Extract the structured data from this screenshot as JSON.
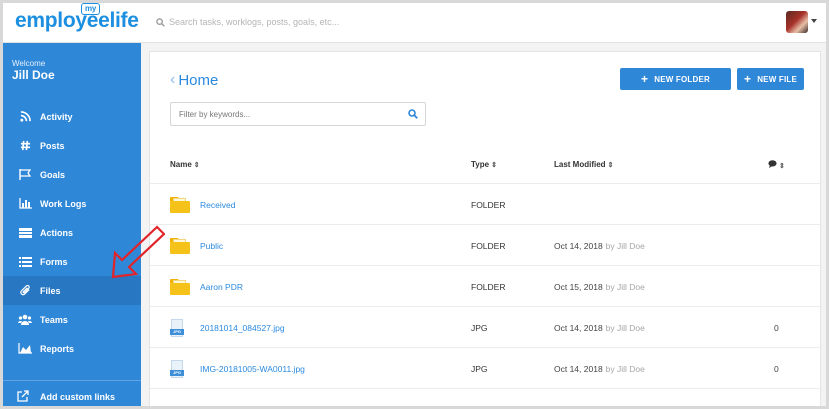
{
  "app": {
    "logo_my": "my",
    "logo_text": "employeelife",
    "search_placeholder": "Search tasks, worklogs, posts, goals, etc..."
  },
  "sidebar": {
    "welcome": "Welcome",
    "user_name": "Jill Doe",
    "items": [
      {
        "label": "Activity",
        "icon": "rss-icon"
      },
      {
        "label": "Posts",
        "icon": "hashtag-icon"
      },
      {
        "label": "Goals",
        "icon": "flag-icon"
      },
      {
        "label": "Work Logs",
        "icon": "bar-chart-icon"
      },
      {
        "label": "Actions",
        "icon": "list-box-icon"
      },
      {
        "label": "Forms",
        "icon": "list-icon"
      },
      {
        "label": "Files",
        "icon": "paperclip-icon",
        "active": true
      },
      {
        "label": "Teams",
        "icon": "users-icon"
      },
      {
        "label": "Reports",
        "icon": "area-chart-icon"
      }
    ],
    "custom_links_label": "Add custom links"
  },
  "main": {
    "title": "Home",
    "new_folder_label": "NEW FOLDER",
    "new_file_label": "NEW FILE",
    "filter_placeholder": "Filter by keywords...",
    "columns": {
      "name": "Name",
      "type": "Type",
      "modified": "Last Modified",
      "comments_icon": "comment-icon"
    },
    "rows": [
      {
        "kind": "folder",
        "name": "Received",
        "type": "FOLDER",
        "modified": "",
        "by": "",
        "comments": ""
      },
      {
        "kind": "folder",
        "name": "Public",
        "type": "FOLDER",
        "modified": "Oct 14, 2018",
        "by": "by Jill Doe",
        "comments": ""
      },
      {
        "kind": "folder",
        "name": "Aaron PDR",
        "type": "FOLDER",
        "modified": "Oct 15, 2018",
        "by": "by Jill Doe",
        "comments": ""
      },
      {
        "kind": "file",
        "name": "20181014_084527.jpg",
        "type": "JPG",
        "modified": "Oct 14, 2018",
        "by": "by Jill Doe",
        "comments": "0"
      },
      {
        "kind": "file",
        "name": "IMG-20181005-WA0011.jpg",
        "type": "JPG",
        "modified": "Oct 14, 2018",
        "by": "by Jill Doe",
        "comments": "0"
      }
    ],
    "file_badge": "JPG"
  },
  "colors": {
    "accent": "#2f87d8",
    "folder": "#f5c21a",
    "annotation_arrow": "#e0242a"
  }
}
